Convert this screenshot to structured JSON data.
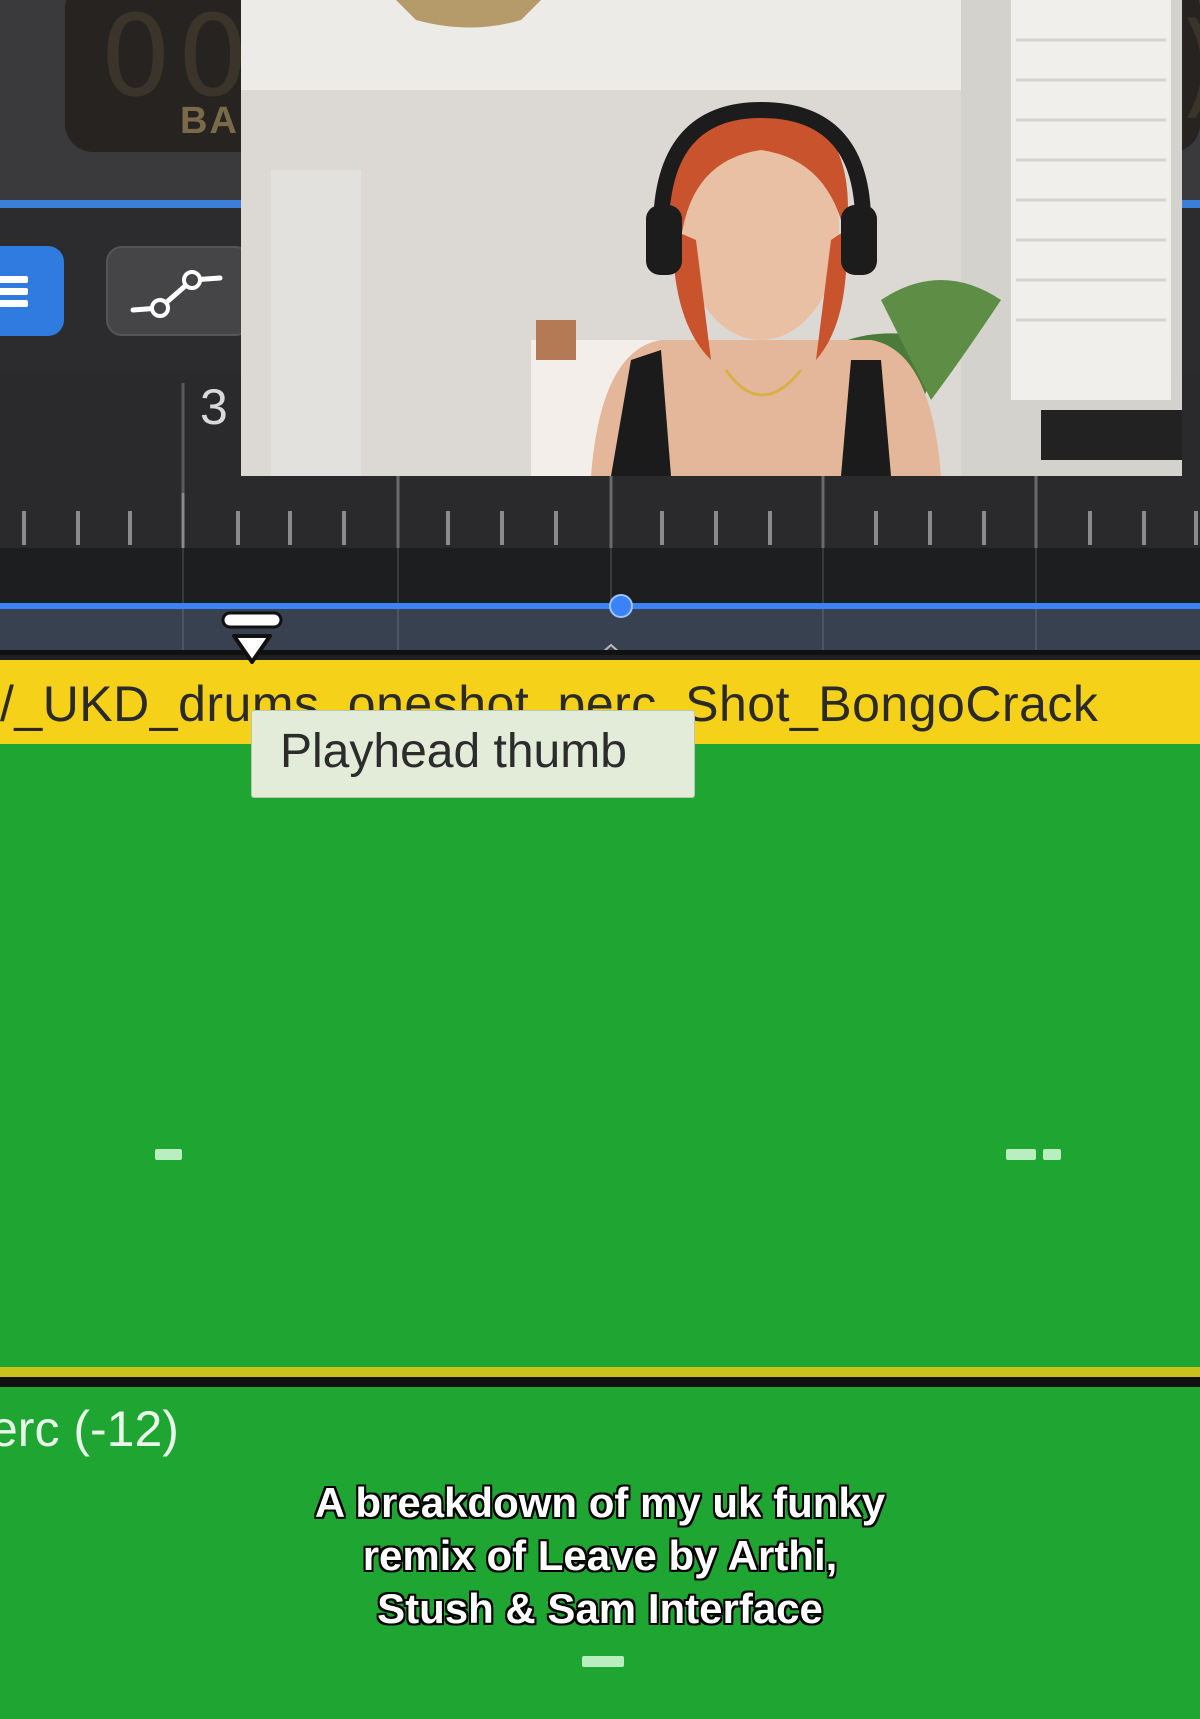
{
  "header": {
    "lcd_digits": "00",
    "lcd_label": "BA",
    "lcd_right_digit": ")"
  },
  "toolbar": {
    "list_view_icon": "list-icon",
    "automation_icon": "automation-curve-icon"
  },
  "ruler": {
    "bar_number": "3"
  },
  "playhead": {
    "icon": "playhead-thumb-icon"
  },
  "tooltip": {
    "text": "Playhead thumb"
  },
  "regions": [
    {
      "name": "/_UKD_drums_oneshot_perc_Shot_BongoCrack",
      "color": "#f6d11a"
    },
    {
      "name": "erc (-12)",
      "color": "#1fa531"
    }
  ],
  "caption": {
    "lines": [
      "A breakdown of my uk funky",
      "remix of Leave by Arthi,",
      "Stush & Sam Interface"
    ]
  },
  "colors": {
    "accent_blue": "#3b82f6",
    "region_green": "#1fa531",
    "region_yellow": "#f6d11a"
  }
}
